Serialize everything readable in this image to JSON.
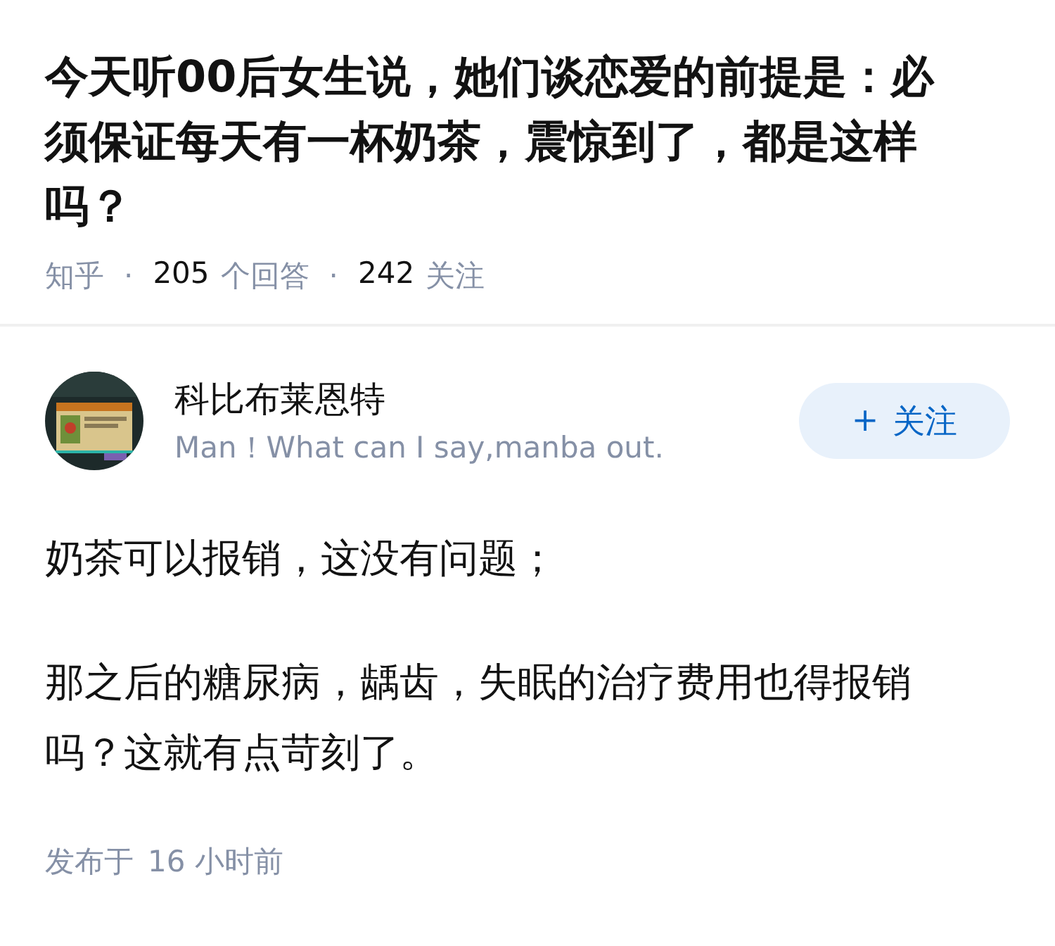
{
  "question": {
    "title": "今天听00后女生说，她们谈恋爱的前提是：必须保证每天有一杯奶茶，震惊到了，都是这样吗？",
    "meta": {
      "source": "知乎",
      "separators": [
        "·",
        "·"
      ],
      "answers": {
        "value": "205",
        "label": "个回答"
      },
      "followers": {
        "value": "242",
        "label": "关注"
      }
    }
  },
  "answer": {
    "author": {
      "name": "科比布莱恩特",
      "bio": "Man！What can I say,manba out."
    },
    "follow_button": {
      "icon": "+",
      "label": "关注"
    },
    "paragraphs": [
      "奶茶可以报销，这没有问题；",
      "那之后的糖尿病，龋齿，失眠的治疗费用也得报销吗？这就有点苛刻了。"
    ],
    "footer": {
      "label": "发布于",
      "time": "16 小时前"
    }
  }
}
